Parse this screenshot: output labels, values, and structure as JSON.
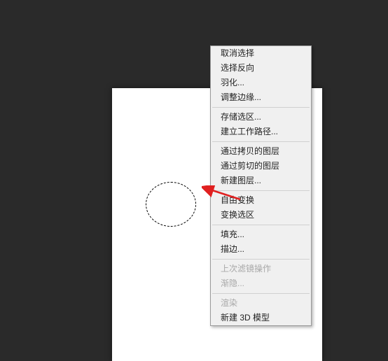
{
  "context_menu": {
    "group1": [
      {
        "label": "取消选择",
        "disabled": false
      },
      {
        "label": "选择反向",
        "disabled": false
      },
      {
        "label": "羽化...",
        "disabled": false
      },
      {
        "label": "调整边缘...",
        "disabled": false
      }
    ],
    "group2": [
      {
        "label": "存储选区...",
        "disabled": false
      },
      {
        "label": "建立工作路径...",
        "disabled": false
      }
    ],
    "group3": [
      {
        "label": "通过拷贝的图层",
        "disabled": false
      },
      {
        "label": "通过剪切的图层",
        "disabled": false
      },
      {
        "label": "新建图层...",
        "disabled": false
      }
    ],
    "group4": [
      {
        "label": "自由变换",
        "disabled": false
      },
      {
        "label": "变换选区",
        "disabled": false
      }
    ],
    "group5": [
      {
        "label": "填充...",
        "disabled": false
      },
      {
        "label": "描边...",
        "disabled": false
      }
    ],
    "group6": [
      {
        "label": "上次滤镜操作",
        "disabled": true
      },
      {
        "label": "渐隐...",
        "disabled": true
      }
    ],
    "group7": [
      {
        "label": "渲染",
        "disabled": true
      },
      {
        "label": "新建 3D 模型",
        "disabled": false
      }
    ]
  },
  "annotation": {
    "arrow_color": "#e02020"
  }
}
